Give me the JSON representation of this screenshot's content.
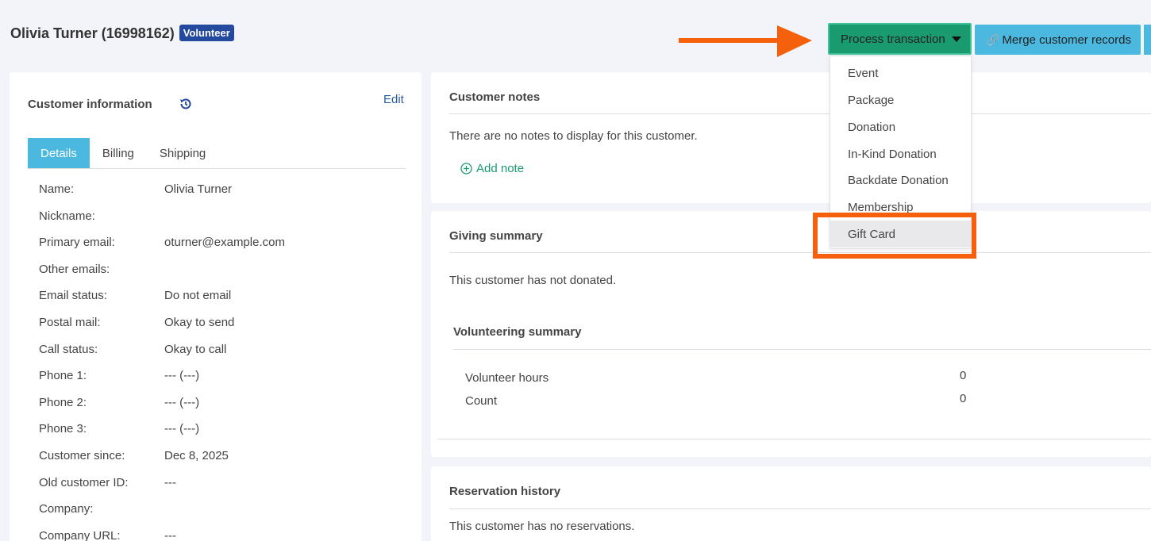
{
  "header": {
    "customer_title": "Olivia Turner (16998162)",
    "badge": "Volunteer",
    "process_button": "Process transaction",
    "merge_button": "Merge customer records"
  },
  "annotation": {
    "arrow_color": "#f4600c",
    "box_color": "#f4600c"
  },
  "dropdown": {
    "items": [
      "Event",
      "Package",
      "Donation",
      "In-Kind Donation",
      "Backdate Donation",
      "Membership",
      "Gift Card"
    ]
  },
  "customer_info": {
    "title": "Customer information",
    "edit": "Edit",
    "tabs": [
      "Details",
      "Billing",
      "Shipping"
    ],
    "fields": [
      {
        "label": "Name:",
        "value": "Olivia Turner"
      },
      {
        "label": "Nickname:",
        "value": ""
      },
      {
        "label": "Primary email:",
        "value": "oturner@example.com"
      },
      {
        "label": "Other emails:",
        "value": ""
      },
      {
        "label": "Email status:",
        "value": "Do not email"
      },
      {
        "label": "Postal mail:",
        "value": "Okay to send"
      },
      {
        "label": "Call status:",
        "value": "Okay to call"
      },
      {
        "label": "Phone 1:",
        "value": "--- (---)"
      },
      {
        "label": "Phone 2:",
        "value": "--- (---)"
      },
      {
        "label": "Phone 3:",
        "value": "--- (---)"
      },
      {
        "label": "Customer since:",
        "value": "Dec 8, 2025"
      },
      {
        "label": "Old customer ID:",
        "value": "---"
      },
      {
        "label": "Company:",
        "value": ""
      },
      {
        "label": "Company URL:",
        "value": "---"
      }
    ]
  },
  "notes": {
    "title": "Customer notes",
    "empty": "There are no notes to display for this customer.",
    "add": "Add note"
  },
  "giving": {
    "title": "Giving summary",
    "empty": "This customer has not donated."
  },
  "volunteering": {
    "title": "Volunteering summary",
    "hours_label": "Volunteer hours",
    "hours_value": "0",
    "count_label": "Count",
    "count_value": "0"
  },
  "reservations": {
    "title": "Reservation history",
    "empty": "This customer has no reservations."
  }
}
